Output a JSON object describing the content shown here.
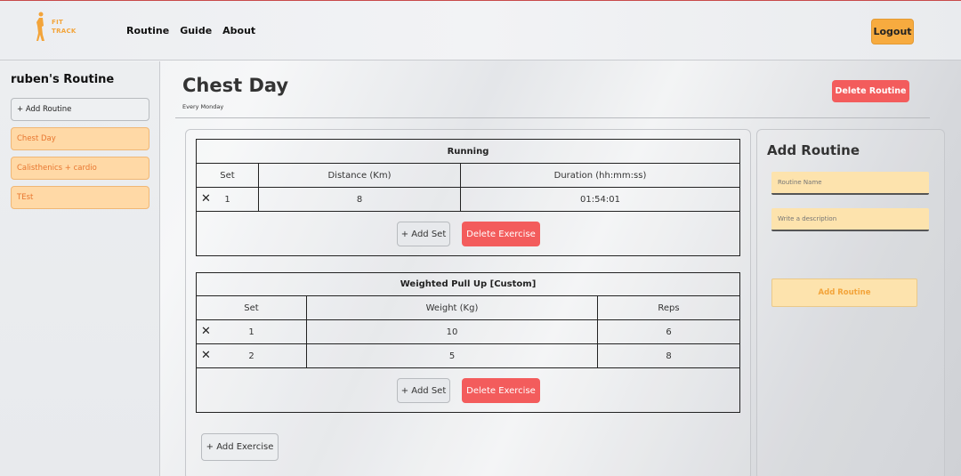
{
  "header": {
    "logo_line1": "FIT",
    "logo_line2": "TRACK",
    "nav": [
      "Routine",
      "Guide",
      "About"
    ],
    "logout_label": "Logout"
  },
  "sidebar": {
    "title": "ruben's Routine",
    "add_label": "+ Add Routine",
    "routines": [
      "Chest Day",
      "Calisthenics + cardio",
      "TEst"
    ]
  },
  "main": {
    "title": "Chest Day",
    "subtitle": "Every Monday",
    "delete_routine_label": "Delete Routine",
    "add_exercise_label": "+ Add Exercise",
    "exercises": [
      {
        "name": "Running",
        "columns": [
          "Set",
          "Distance (Km)",
          "Duration (hh:mm:ss)"
        ],
        "rows": [
          [
            "1",
            "8",
            "01:54:01"
          ]
        ],
        "add_set_label": "+ Add Set",
        "delete_label": "Delete Exercise"
      },
      {
        "name": "Weighted Pull Up [Custom]",
        "columns": [
          "Set",
          "Weight (Kg)",
          "Reps"
        ],
        "rows": [
          [
            "1",
            "10",
            "6"
          ],
          [
            "2",
            "5",
            "8"
          ]
        ],
        "add_set_label": "+ Add Set",
        "delete_label": "Delete Exercise"
      }
    ]
  },
  "form": {
    "title": "Add Routine",
    "name_placeholder": "Routine Name",
    "description_placeholder": "Write a description",
    "submit_label": "Add Routine"
  },
  "colors": {
    "accent_orange": "#f7ab3f",
    "danger_red": "#f35c5c",
    "routine_bg": "#ffd9a6",
    "input_bg": "#fde3ad"
  }
}
